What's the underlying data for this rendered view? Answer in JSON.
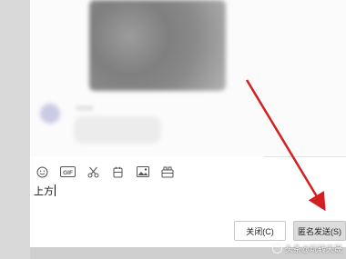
{
  "toolbar": {
    "icons": [
      "emoji-icon",
      "gif-icon",
      "scissors-icon",
      "bottle-icon",
      "image-icon",
      "chat-history-icon"
    ],
    "gif_label": "GIF"
  },
  "input": {
    "value": "上方"
  },
  "buttons": {
    "close_label": "关闭(C)",
    "send_label": "匿名发送(S)"
  },
  "watermark": {
    "text": "头条@玩转天晟"
  },
  "colors": {
    "arrow": "#d31f1f",
    "send_button_bg": "#dcdcdc"
  }
}
